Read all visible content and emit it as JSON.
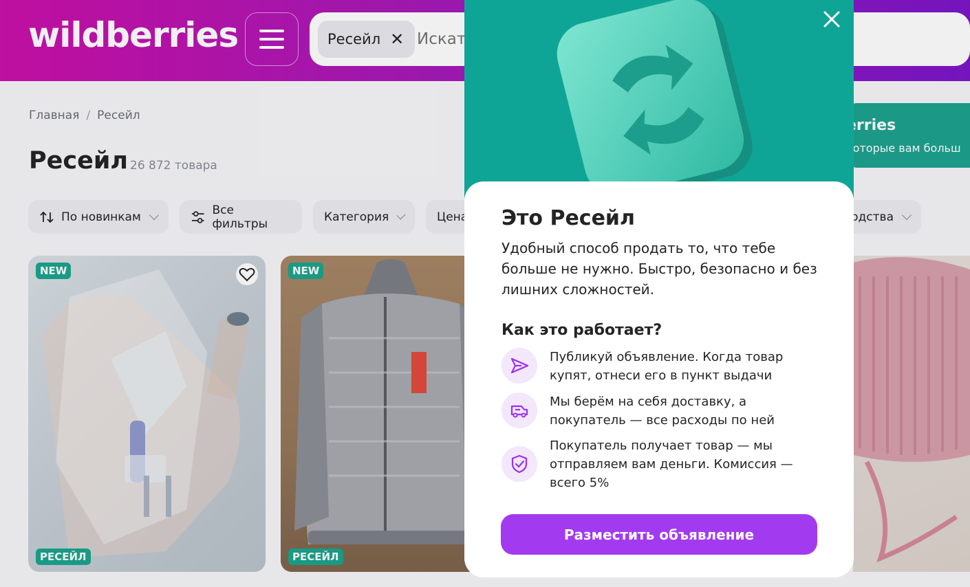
{
  "header": {
    "logo": "wildberries",
    "search": {
      "chip_label": "Ресейл",
      "placeholder": "Искать"
    }
  },
  "breadcrumb": {
    "home": "Главная",
    "separator": "/",
    "current": "Ресейл"
  },
  "page": {
    "title": "Ресейл",
    "count": "26 872 товара"
  },
  "filters": {
    "sort": "По новинкам",
    "all": "Все фильтры",
    "category": "Категория",
    "price": "Цена",
    "origin": "одства"
  },
  "promo": {
    "title": "erries",
    "subtitle": "которые вам больш"
  },
  "cards": [
    {
      "badge_new": "NEW",
      "badge_resale": "РЕСЕЙЛ"
    },
    {
      "badge_new": "NEW",
      "badge_resale": "РЕСЕЙЛ"
    }
  ],
  "modal": {
    "title": "Это Ресейл",
    "description": "Удобный способ продать то, что тебе больше не нужно. Быстро, безопасно и без лишних сложностей.",
    "subtitle": "Как это работает?",
    "steps": [
      {
        "icon": "send-icon",
        "text": "Публикуй объявление. Когда товар купят, отнеси его в пункт выдачи"
      },
      {
        "icon": "delivery-truck-icon",
        "text": "Мы берём на себя доставку, а покупатель — все расходы по ней"
      },
      {
        "icon": "shield-check-icon",
        "text": "Покупатель получает товар — мы отправляем вам деньги. Комиссия — всего 5%"
      }
    ],
    "cta": "Разместить объявление"
  },
  "colors": {
    "brand_start": "#cb11ab",
    "brand_end": "#7d16c9",
    "teal": "#0fa596",
    "cta": "#a23bf0",
    "badge": "#1ba48e"
  }
}
